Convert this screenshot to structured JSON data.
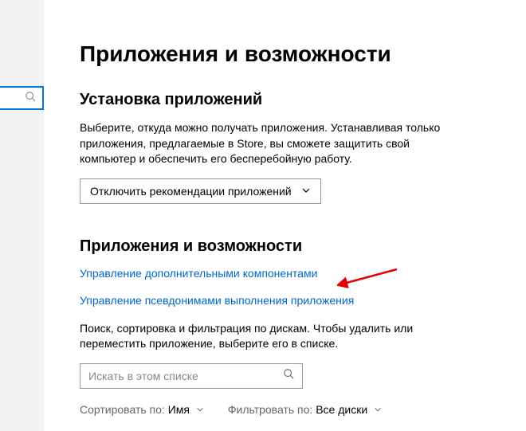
{
  "page": {
    "title": "Приложения и возможности"
  },
  "section1": {
    "heading": "Установка приложений",
    "description": "Выберите, откуда можно получать приложения. Устанавливая только приложения, предлагаемые в Store, вы сможете защитить свой компьютер и обеспечить его бесперебойную работу.",
    "dropdown_label": "Отключить рекомендации приложений"
  },
  "section2": {
    "heading": "Приложения и возможности",
    "link_optional": "Управление дополнительными компонентами",
    "link_aliases": "Управление псевдонимами выполнения приложения",
    "description": "Поиск, сортировка и фильтрация по дискам. Чтобы удалить или переместить приложение, выберите его в списке.",
    "search_placeholder": "Искать в этом списке",
    "sort_label": "Сортировать по:",
    "sort_value": "Имя",
    "filter_label": "Фильтровать по:",
    "filter_value": "Все диски"
  }
}
